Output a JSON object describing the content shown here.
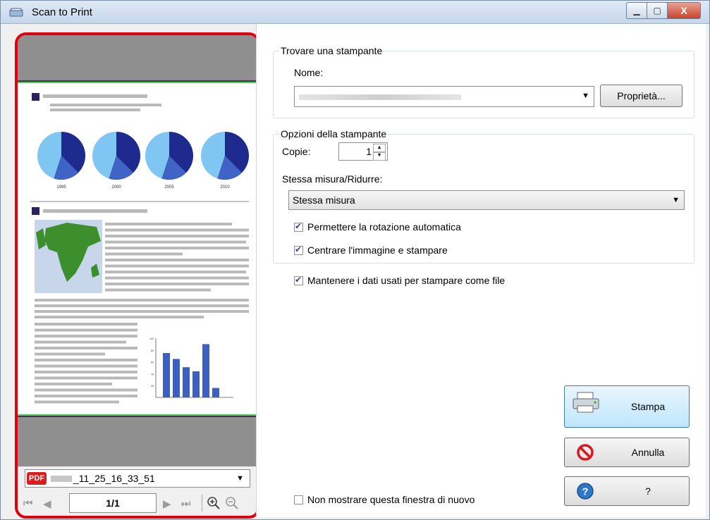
{
  "window": {
    "title": "Scan to Print",
    "min_label": "▭",
    "max_label": "▢",
    "close_label": "X"
  },
  "preview": {
    "file_type": "PDF",
    "file_name": "_11_25_16_33_51",
    "page_indicator": "1/1",
    "page_content": {
      "pie_labels": [
        "1995",
        "2000",
        "2005",
        "2010"
      ],
      "bar_ticks": [
        "100",
        "80",
        "60",
        "40",
        "20"
      ],
      "bar_values": [
        75,
        65,
        51,
        44,
        90,
        16
      ]
    }
  },
  "printer_group": {
    "legend": "Trovare una stampante",
    "name_label": "Nome:",
    "properties_button": "Proprietà..."
  },
  "options_group": {
    "legend": "Opzioni della stampante",
    "copies_label": "Copie:",
    "copies_value": "1",
    "size_label": "Stessa misura/Ridurre:",
    "size_value": "Stessa misura",
    "auto_rotate": {
      "label": "Permettere la rotazione automatica",
      "checked": true
    },
    "center": {
      "label": "Centrare l'immagine e stampare",
      "checked": true
    }
  },
  "keep_data": {
    "label": "Mantenere i dati usati per stampare come file",
    "checked": true
  },
  "dont_show": {
    "label": "Non mostrare questa finestra di nuovo",
    "checked": false
  },
  "buttons": {
    "print": "Stampa",
    "cancel": "Annulla",
    "help": "?"
  },
  "colors": {
    "highlight": "#e0000e",
    "pie_dark": "#1f2a8f",
    "pie_mid": "#3f64c5",
    "pie_light": "#7fc6f3",
    "bars": "#3d5fc4",
    "map_green": "#3d8f2e",
    "map_water": "#c8d6ec"
  }
}
